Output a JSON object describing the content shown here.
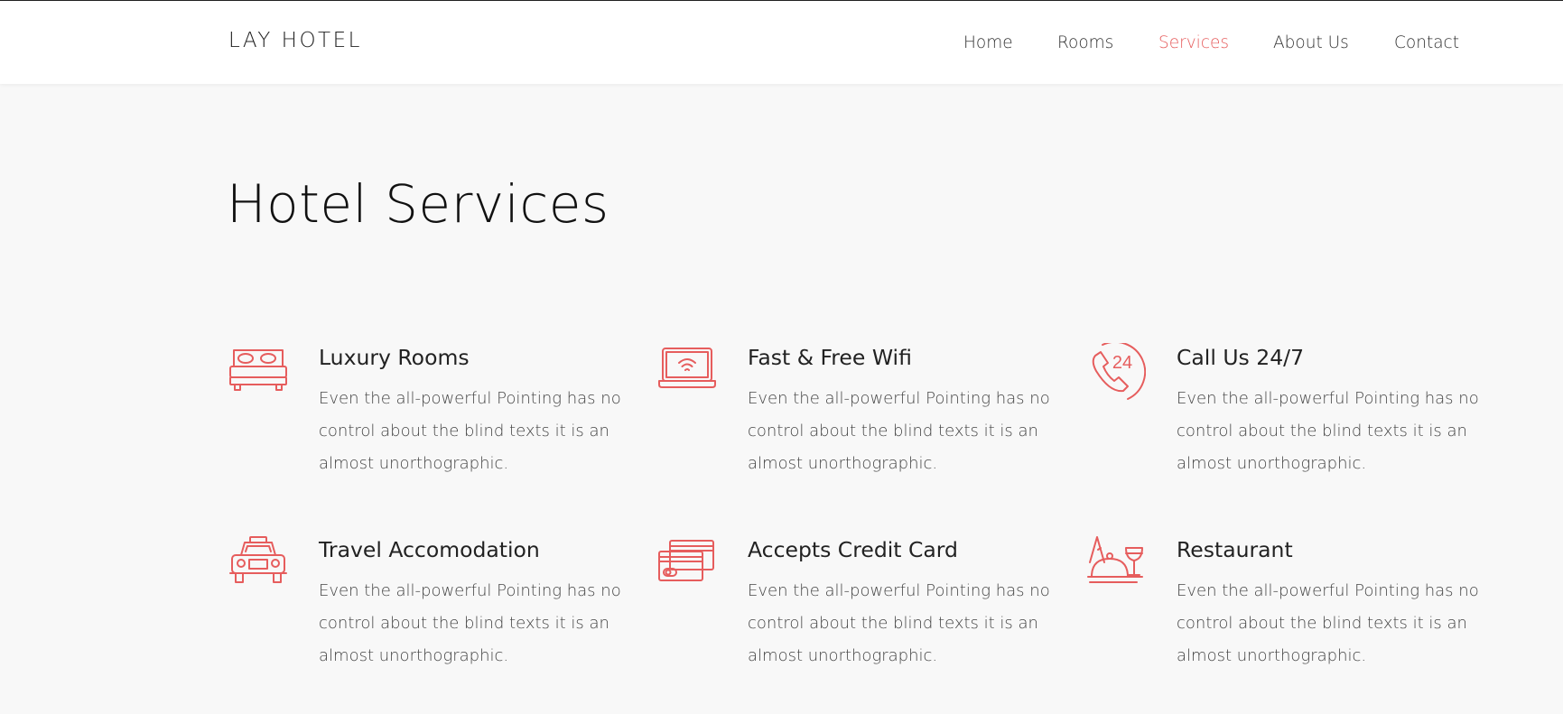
{
  "brand": "LAY HOTEL",
  "nav": {
    "home": "Home",
    "rooms": "Rooms",
    "services": "Services",
    "about": "About Us",
    "contact": "Contact",
    "active": "services"
  },
  "section": {
    "title": "Hotel Services"
  },
  "colors": {
    "accent": "#e65d5d",
    "background": "#f8f8f8",
    "navbar": "#ffffff"
  },
  "services": [
    {
      "icon": "bed-icon",
      "title": "Luxury Rooms",
      "desc": "Even the all-powerful Pointing has no control about the blind texts it is an almost unorthographic."
    },
    {
      "icon": "laptop-wifi-icon",
      "title": "Fast & Free Wifi",
      "desc": "Even the all-powerful Pointing has no control about the blind texts it is an almost unorthographic."
    },
    {
      "icon": "phone-24-icon",
      "title": "Call Us 24/7",
      "desc": "Even the all-powerful Pointing has no control about the blind texts it is an almost unorthographic."
    },
    {
      "icon": "car-icon",
      "title": "Travel Accomodation",
      "desc": "Even the all-powerful Pointing has no control about the blind texts it is an almost unorthographic."
    },
    {
      "icon": "credit-card-icon",
      "title": "Accepts Credit Card",
      "desc": "Even the all-powerful Pointing has no control about the blind texts it is an almost unorthographic."
    },
    {
      "icon": "restaurant-icon",
      "title": "Restaurant",
      "desc": "Even the all-powerful Pointing has no control about the blind texts it is an almost unorthographic."
    }
  ]
}
